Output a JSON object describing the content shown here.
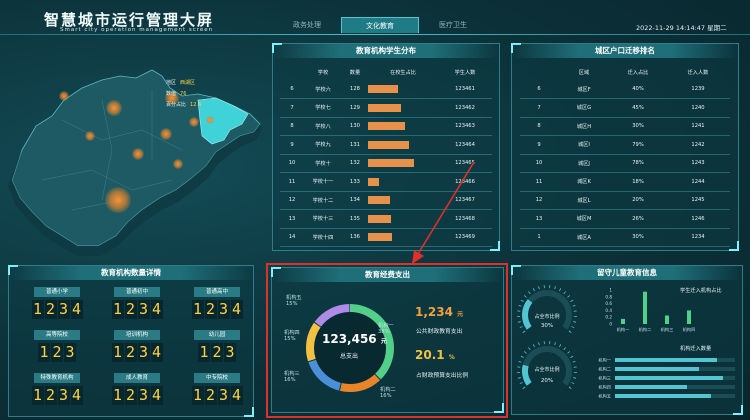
{
  "header": {
    "title": "智慧城市运行管理大屏",
    "subtitle": "Smart city operation management screen",
    "tabs": [
      {
        "label": "政务处理"
      },
      {
        "label": "文化教育"
      },
      {
        "label": "医疗卫生"
      }
    ],
    "active_tab": 1,
    "datetime": "2022-11-29 14:14:47 星期二"
  },
  "map": {
    "legend": [
      {
        "label": "地区",
        "value": "西湖区"
      },
      {
        "label": "数值",
        "value": "76"
      },
      {
        "label": "百分占比",
        "value": "12.4"
      }
    ],
    "colors": {
      "land": "#1d5a64",
      "highlight": "#3fd2d8",
      "bubble": "#e8852a"
    }
  },
  "school_table": {
    "title": "教育机构学生分布",
    "headers": [
      "",
      "学校",
      "数量",
      "在校生占比",
      "学生人数"
    ],
    "rows": [
      {
        "idx": "6",
        "name": "学校六",
        "count": "128",
        "ratio": 0.5,
        "students": "123461"
      },
      {
        "idx": "7",
        "name": "学校七",
        "count": "129",
        "ratio": 0.55,
        "students": "123462"
      },
      {
        "idx": "8",
        "name": "学校八",
        "count": "130",
        "ratio": 0.62,
        "students": "123463"
      },
      {
        "idx": "9",
        "name": "学校九",
        "count": "131",
        "ratio": 0.68,
        "students": "123464"
      },
      {
        "idx": "10",
        "name": "学校十",
        "count": "132",
        "ratio": 0.76,
        "students": "123465"
      },
      {
        "idx": "11",
        "name": "学校十一",
        "count": "133",
        "ratio": 0.18,
        "students": "123466"
      },
      {
        "idx": "12",
        "name": "学校十二",
        "count": "134",
        "ratio": 0.36,
        "students": "123467"
      },
      {
        "idx": "13",
        "name": "学校十三",
        "count": "135",
        "ratio": 0.38,
        "students": "123468"
      },
      {
        "idx": "14",
        "name": "学校十四",
        "count": "136",
        "ratio": 0.4,
        "students": "123469"
      }
    ]
  },
  "district_table": {
    "title": "城区户口迁移排名",
    "headers": [
      "",
      "区域",
      "迁入占比",
      "迁入人数"
    ],
    "rows": [
      {
        "idx": "6",
        "name": "城区F",
        "pct": "40%",
        "num": "1239"
      },
      {
        "idx": "7",
        "name": "城区G",
        "pct": "45%",
        "num": "1240"
      },
      {
        "idx": "8",
        "name": "城区H",
        "pct": "30%",
        "num": "1241"
      },
      {
        "idx": "9",
        "name": "城区I",
        "pct": "79%",
        "num": "1242"
      },
      {
        "idx": "10",
        "name": "城区J",
        "pct": "78%",
        "num": "1243"
      },
      {
        "idx": "11",
        "name": "城区K",
        "pct": "18%",
        "num": "1244"
      },
      {
        "idx": "12",
        "name": "城区L",
        "pct": "20%",
        "num": "1245"
      },
      {
        "idx": "13",
        "name": "城区M",
        "pct": "26%",
        "num": "1246"
      },
      {
        "idx": "1",
        "name": "城区A",
        "pct": "30%",
        "num": "1234"
      }
    ]
  },
  "institutions": {
    "title": "教育机构数量详情",
    "items": [
      {
        "label": "普通小学",
        "value": "1234"
      },
      {
        "label": "普通初中",
        "value": "1234"
      },
      {
        "label": "普通高中",
        "value": "1234"
      },
      {
        "label": "高等院校",
        "value": "123"
      },
      {
        "label": "培训机构",
        "value": "1234"
      },
      {
        "label": "幼儿园",
        "value": "123"
      },
      {
        "label": "特殊教育机构",
        "value": "1234"
      },
      {
        "label": "成人教育",
        "value": "1234"
      },
      {
        "label": "中专院校",
        "value": "1234"
      }
    ]
  },
  "expense": {
    "title": "教育经费支出",
    "total": "123,456",
    "total_unit": "元",
    "total_label": "总支出",
    "segments": [
      {
        "name": "机构一",
        "pct": 38,
        "pct_label": "38%",
        "color": "#52d08a"
      },
      {
        "name": "机构二",
        "pct": 16,
        "pct_label": "16%",
        "color": "#e8852a"
      },
      {
        "name": "机构三",
        "pct": 16,
        "pct_label": "16%",
        "color": "#4a8fd8"
      },
      {
        "name": "机构四",
        "pct": 15,
        "pct_label": "15%",
        "color": "#f2c043"
      },
      {
        "name": "机构五",
        "pct": 15,
        "pct_label": "15%",
        "color": "#b08ae8"
      }
    ],
    "stat1": {
      "value": "1,234",
      "unit": "元",
      "label": "公共财政教育支出"
    },
    "stat2": {
      "value": "20.1",
      "unit": "%",
      "label": "占财政预算支出比例"
    }
  },
  "left_behind": {
    "title": "留守儿童教育信息",
    "gauges": [
      {
        "line1": "占全市",
        "line2": "比例",
        "value": "30%",
        "ratio": 0.3
      },
      {
        "line1": "占全市",
        "line2": "比例",
        "value": "20%",
        "ratio": 0.2
      }
    ],
    "bar_title": "学生迁入机构占比",
    "bar_ticks": [
      "1",
      "0.8",
      "0.6",
      "0.4",
      "0.2",
      "0"
    ],
    "bars": [
      {
        "label": "机构一",
        "value": 0.15
      },
      {
        "label": "机构二",
        "value": 0.95
      },
      {
        "label": "机构三",
        "value": 0.25
      },
      {
        "label": "机构四",
        "value": 0.4
      }
    ],
    "hbar_title": "机构迁入数量",
    "hbars": [
      {
        "label": "机构一",
        "value": 0.85
      },
      {
        "label": "机构二",
        "value": 0.7
      },
      {
        "label": "机构三",
        "value": 0.9
      },
      {
        "label": "机构四",
        "value": 0.6
      },
      {
        "label": "机构五",
        "value": 0.8
      }
    ]
  }
}
